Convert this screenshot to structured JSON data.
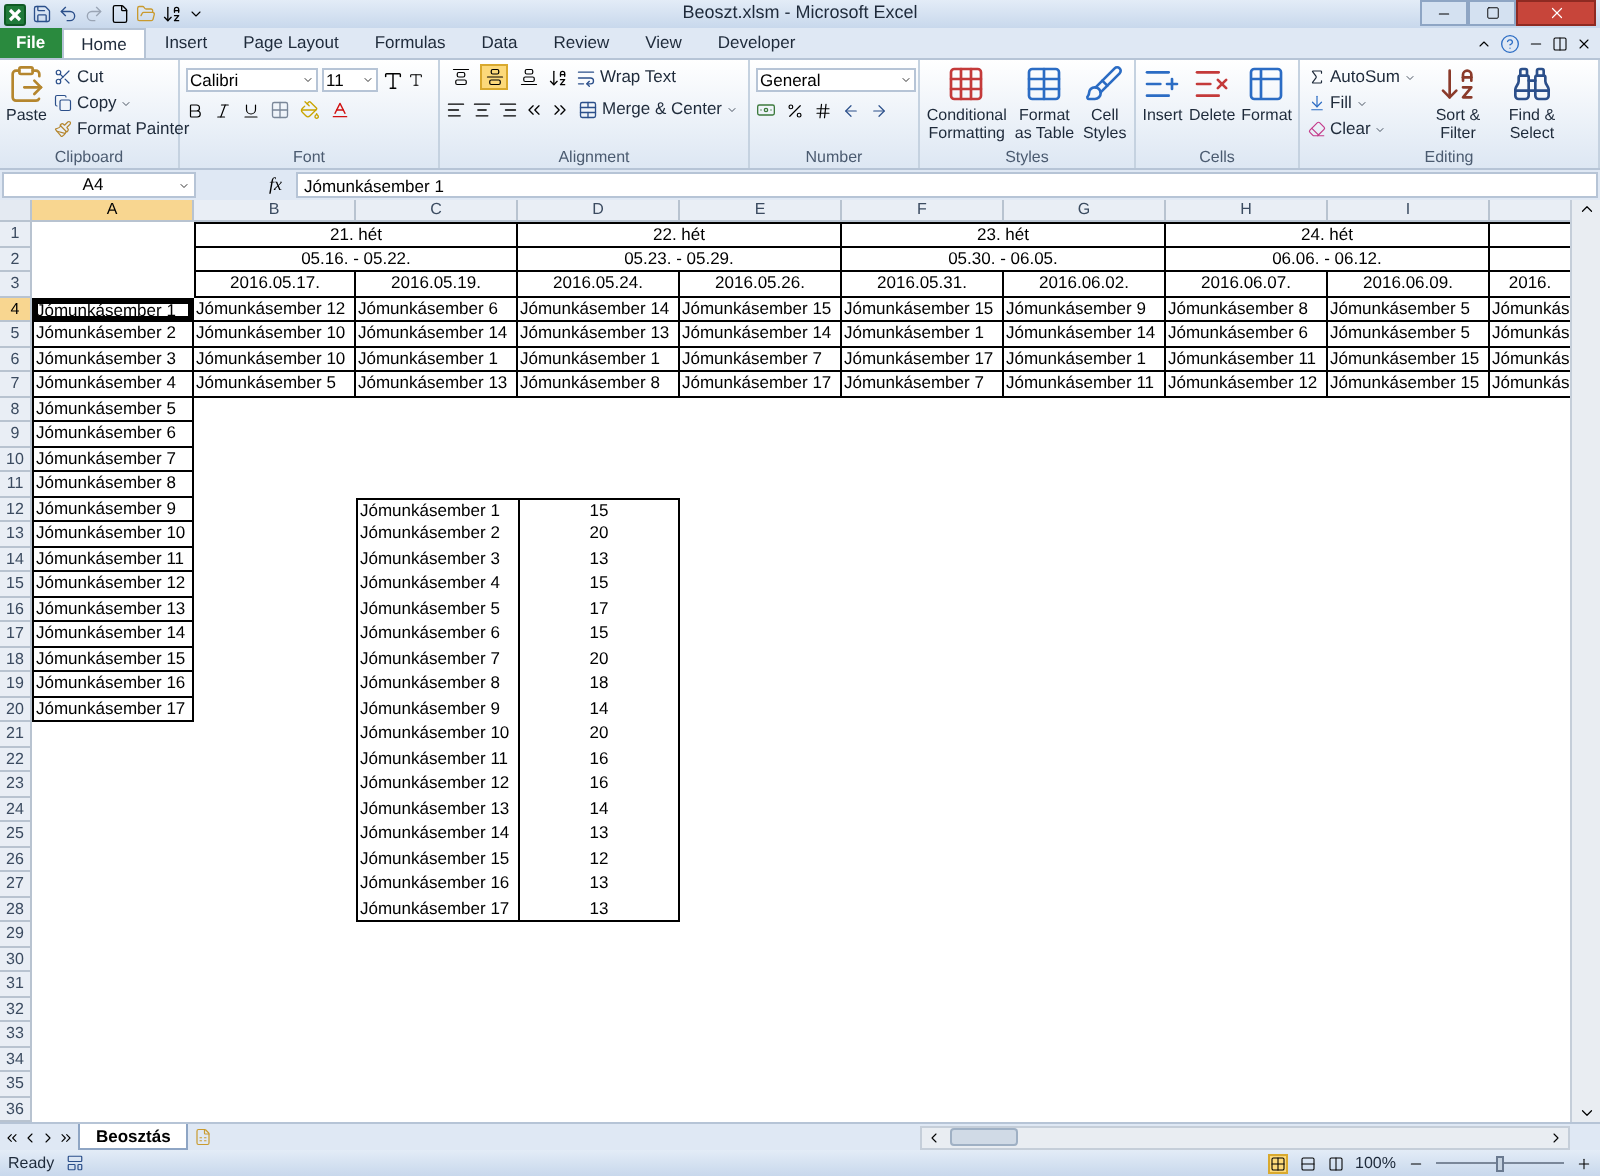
{
  "window": {
    "title": "Beoszt.xlsm - Microsoft Excel"
  },
  "tabs": [
    {
      "label": "File",
      "selected": false,
      "kind": "file"
    },
    {
      "label": "Home",
      "selected": true,
      "kind": "tab"
    },
    {
      "label": "Insert",
      "selected": false,
      "kind": "tab"
    },
    {
      "label": "Page Layout",
      "selected": false,
      "kind": "tab"
    },
    {
      "label": "Formulas",
      "selected": false,
      "kind": "tab"
    },
    {
      "label": "Data",
      "selected": false,
      "kind": "tab"
    },
    {
      "label": "Review",
      "selected": false,
      "kind": "tab"
    },
    {
      "label": "View",
      "selected": false,
      "kind": "tab"
    },
    {
      "label": "Developer",
      "selected": false,
      "kind": "tab"
    }
  ],
  "ribbon": {
    "clipboard": {
      "label": "Clipboard",
      "paste": "Paste",
      "cut": "Cut",
      "copy": "Copy",
      "format_painter": "Format Painter"
    },
    "font": {
      "label": "Font",
      "family": "Calibri",
      "size": "11"
    },
    "alignment": {
      "label": "Alignment",
      "wrap_text": "Wrap Text",
      "merge_center": "Merge & Center",
      "vertical_align": [
        {
          "selected": false
        },
        {
          "selected": true
        },
        {
          "selected": false
        }
      ]
    },
    "number": {
      "label": "Number",
      "format": "General"
    },
    "styles": {
      "label": "Styles",
      "conditional": "Conditional Formatting",
      "as_table": "Format as Table",
      "cell_styles": "Cell Styles"
    },
    "cells": {
      "label": "Cells",
      "insert": "Insert",
      "delete": "Delete",
      "format": "Format"
    },
    "editing": {
      "label": "Editing",
      "autosum": "AutoSum",
      "fill": "Fill",
      "clear": "Clear",
      "sort_filter": "Sort & Filter",
      "find_select": "Find & Select"
    }
  },
  "formula_bar": {
    "name_box": "A4",
    "function_label": "fx",
    "value": "Jómunkásember 1"
  },
  "column_headers": [
    {
      "label": "A",
      "selected": true
    },
    {
      "label": "B",
      "selected": false
    },
    {
      "label": "C",
      "selected": false
    },
    {
      "label": "D",
      "selected": false
    },
    {
      "label": "E",
      "selected": false
    },
    {
      "label": "F",
      "selected": false
    },
    {
      "label": "G",
      "selected": false
    },
    {
      "label": "H",
      "selected": false
    },
    {
      "label": "I",
      "selected": false
    }
  ],
  "row_headers": [
    {
      "label": "1",
      "selected": false
    },
    {
      "label": "2",
      "selected": false
    },
    {
      "label": "3",
      "selected": false
    },
    {
      "label": "4",
      "selected": true
    },
    {
      "label": "5",
      "selected": false
    },
    {
      "label": "6",
      "selected": false
    },
    {
      "label": "7",
      "selected": false
    },
    {
      "label": "8",
      "selected": false
    },
    {
      "label": "9",
      "selected": false
    },
    {
      "label": "10",
      "selected": false
    },
    {
      "label": "11",
      "selected": false
    },
    {
      "label": "12",
      "selected": false
    },
    {
      "label": "13",
      "selected": false
    },
    {
      "label": "14",
      "selected": false
    },
    {
      "label": "15",
      "selected": false
    },
    {
      "label": "16",
      "selected": false
    },
    {
      "label": "17",
      "selected": false
    },
    {
      "label": "18",
      "selected": false
    },
    {
      "label": "19",
      "selected": false
    },
    {
      "label": "20",
      "selected": false
    },
    {
      "label": "21",
      "selected": false
    },
    {
      "label": "22",
      "selected": false
    },
    {
      "label": "23",
      "selected": false
    },
    {
      "label": "24",
      "selected": false
    },
    {
      "label": "25",
      "selected": false
    },
    {
      "label": "26",
      "selected": false
    },
    {
      "label": "27",
      "selected": false
    },
    {
      "label": "28",
      "selected": false
    },
    {
      "label": "29",
      "selected": false
    },
    {
      "label": "30",
      "selected": false
    },
    {
      "label": "31",
      "selected": false
    },
    {
      "label": "32",
      "selected": false
    },
    {
      "label": "33",
      "selected": false
    },
    {
      "label": "34",
      "selected": false
    },
    {
      "label": "35",
      "selected": false
    },
    {
      "label": "36",
      "selected": false
    }
  ],
  "week_headers": [
    {
      "week": "21. hét",
      "range": "05.16. - 05.22."
    },
    {
      "week": "22. hét",
      "range": "05.23. - 05.29."
    },
    {
      "week": "23. hét",
      "range": "05.30. - 06.05."
    },
    {
      "week": "24. hét",
      "range": "06.06. - 06.12."
    }
  ],
  "dates": [
    "2016.05.17.",
    "2016.05.19.",
    "2016.05.24.",
    "2016.05.26.",
    "2016.05.31.",
    "2016.06.02.",
    "2016.06.07.",
    "2016.06.09.",
    "2016."
  ],
  "schedule": [
    {
      "name": "Jómunkásember 1",
      "selected": true,
      "cells": [
        "Jómunkásember 12",
        "Jómunkásember 6",
        "Jómunkásember 14",
        "Jómunkásember 15",
        "Jómunkásember 15",
        "Jómunkásember 9",
        "Jómunkásember 8",
        "Jómunkásember 5",
        "Jómunkás"
      ]
    },
    {
      "name": "Jómunkásember 2",
      "selected": false,
      "cells": [
        "Jómunkásember 10",
        "Jómunkásember 14",
        "Jómunkásember 13",
        "Jómunkásember 14",
        "Jómunkásember 1",
        "Jómunkásember 14",
        "Jómunkásember 6",
        "Jómunkásember 5",
        "Jómunkás"
      ]
    },
    {
      "name": "Jómunkásember 3",
      "selected": false,
      "cells": [
        "Jómunkásember 10",
        "Jómunkásember 1",
        "Jómunkásember 1",
        "Jómunkásember 7",
        "Jómunkásember 17",
        "Jómunkásember 1",
        "Jómunkásember 11",
        "Jómunkásember 15",
        "Jómunkás"
      ]
    },
    {
      "name": "Jómunkásember 4",
      "selected": false,
      "cells": [
        "Jómunkásember 5",
        "Jómunkásember 13",
        "Jómunkásember 8",
        "Jómunkásember 17",
        "Jómunkásember 7",
        "Jómunkásember 11",
        "Jómunkásember 12",
        "Jómunkásember 15",
        "Jómunkás"
      ]
    }
  ],
  "more_names": [
    "Jómunkásember 5",
    "Jómunkásember 6",
    "Jómunkásember 7",
    "Jómunkásember 8",
    "Jómunkásember 9",
    "Jómunkásember 10",
    "Jómunkásember 11",
    "Jómunkásember 12",
    "Jómunkásember 13",
    "Jómunkásember 14",
    "Jómunkásember 15",
    "Jómunkásember 16",
    "Jómunkásember 17"
  ],
  "summary": [
    {
      "name": "Jómunkásember 1",
      "count": "15"
    },
    {
      "name": "Jómunkásember 2",
      "count": "20"
    },
    {
      "name": "Jómunkásember 3",
      "count": "13"
    },
    {
      "name": "Jómunkásember 4",
      "count": "15"
    },
    {
      "name": "Jómunkásember 5",
      "count": "17"
    },
    {
      "name": "Jómunkásember 6",
      "count": "15"
    },
    {
      "name": "Jómunkásember 7",
      "count": "20"
    },
    {
      "name": "Jómunkásember 8",
      "count": "18"
    },
    {
      "name": "Jómunkásember 9",
      "count": "14"
    },
    {
      "name": "Jómunkásember 10",
      "count": "20"
    },
    {
      "name": "Jómunkásember 11",
      "count": "16"
    },
    {
      "name": "Jómunkásember 12",
      "count": "16"
    },
    {
      "name": "Jómunkásember 13",
      "count": "14"
    },
    {
      "name": "Jómunkásember 14",
      "count": "13"
    },
    {
      "name": "Jómunkásember 15",
      "count": "12"
    },
    {
      "name": "Jómunkásember 16",
      "count": "13"
    },
    {
      "name": "Jómunkásember 17",
      "count": "13"
    }
  ],
  "sheet_tabs": [
    {
      "label": "Beosztás",
      "selected": true
    }
  ],
  "status_bar": {
    "status": "Ready",
    "zoom": "100%",
    "zoom_slider": {
      "level": 0.5
    }
  }
}
